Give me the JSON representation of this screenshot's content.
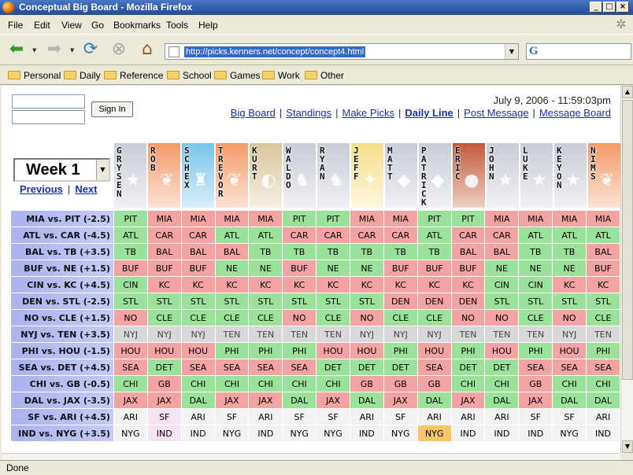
{
  "window": {
    "title": "Conceptual Big Board - Mozilla Firefox"
  },
  "menu": [
    "File",
    "Edit",
    "View",
    "Go",
    "Bookmarks",
    "Tools",
    "Help"
  ],
  "address": {
    "url": "http://picks.kenners.net/concept/concept4.html"
  },
  "search": {
    "engine_glyph": "G"
  },
  "bookmarks": [
    "Personal",
    "Daily",
    "Reference",
    "School",
    "Games",
    "Work",
    "Other"
  ],
  "page": {
    "signin_label": "Sign In",
    "datetime": "July 9, 2006 - 11:59:03pm",
    "nav_links": [
      "Big Board",
      "Standings",
      "Make Picks",
      "Daily Line",
      "Post Message",
      "Message Board"
    ],
    "current_link": "Daily Line",
    "week_label": "Week 1",
    "prev_label": "Previous",
    "next_label": "Next"
  },
  "players": [
    {
      "name": "GRYSEN",
      "bg": "#c8ccd6",
      "logo": "star-logo"
    },
    {
      "name": "ROB",
      "bg": "#f39a6a",
      "logo": "bird-logo"
    },
    {
      "name": "SCHEX",
      "bg": "#79c4ea",
      "logo": "derrick-logo"
    },
    {
      "name": "TREVOR",
      "bg": "#f39a6a",
      "logo": "bird-logo"
    },
    {
      "name": "KURT",
      "bg": "#d9c79a",
      "logo": "helmet-logo"
    },
    {
      "name": "WALDO",
      "bg": "#c8ccd6",
      "logo": "horse-logo"
    },
    {
      "name": "RYAN",
      "bg": "#c8ccd6",
      "logo": "horse-logo"
    },
    {
      "name": "JEFF",
      "bg": "#f6df8a",
      "logo": "steel-logo"
    },
    {
      "name": "MATT",
      "bg": "#c8ccd6",
      "logo": "patriot-logo"
    },
    {
      "name": "PATRICK",
      "bg": "#c8ccd6",
      "logo": "patriot-logo"
    },
    {
      "name": "ERIC",
      "bg": "#c25a3a",
      "logo": "chief-logo"
    },
    {
      "name": "JOHN",
      "bg": "#c8ccd6",
      "logo": "star-logo"
    },
    {
      "name": "LUKE",
      "bg": "#c8ccd6",
      "logo": "star-logo"
    },
    {
      "name": "KEYON",
      "bg": "#c8ccd6",
      "logo": "star-logo"
    },
    {
      "name": "NIMS",
      "bg": "#f39a6a",
      "logo": "bird-logo"
    }
  ],
  "games": [
    {
      "label": "MIA vs. PIT (-2.5)",
      "picks": [
        [
          "PIT",
          "w"
        ],
        [
          "MIA",
          "l"
        ],
        [
          "MIA",
          "l"
        ],
        [
          "MIA",
          "l"
        ],
        [
          "MIA",
          "l"
        ],
        [
          "PIT",
          "w"
        ],
        [
          "PIT",
          "w"
        ],
        [
          "MIA",
          "l"
        ],
        [
          "MIA",
          "l"
        ],
        [
          "PIT",
          "w"
        ],
        [
          "PIT",
          "w"
        ],
        [
          "MIA",
          "l"
        ],
        [
          "MIA",
          "l"
        ],
        [
          "MIA",
          "l"
        ],
        [
          "MIA",
          "l"
        ]
      ]
    },
    {
      "label": "ATL vs. CAR (-4.5)",
      "picks": [
        [
          "ATL",
          "w"
        ],
        [
          "CAR",
          "l"
        ],
        [
          "CAR",
          "l"
        ],
        [
          "ATL",
          "w"
        ],
        [
          "ATL",
          "w"
        ],
        [
          "CAR",
          "l"
        ],
        [
          "CAR",
          "l"
        ],
        [
          "CAR",
          "l"
        ],
        [
          "CAR",
          "l"
        ],
        [
          "ATL",
          "w"
        ],
        [
          "CAR",
          "l"
        ],
        [
          "CAR",
          "l"
        ],
        [
          "ATL",
          "w"
        ],
        [
          "ATL",
          "w"
        ],
        [
          "ATL",
          "w"
        ]
      ]
    },
    {
      "label": "BAL vs. TB (+3.5)",
      "picks": [
        [
          "TB",
          "w"
        ],
        [
          "BAL",
          "l"
        ],
        [
          "BAL",
          "l"
        ],
        [
          "BAL",
          "l"
        ],
        [
          "TB",
          "w"
        ],
        [
          "TB",
          "w"
        ],
        [
          "TB",
          "w"
        ],
        [
          "TB",
          "w"
        ],
        [
          "TB",
          "w"
        ],
        [
          "TB",
          "w"
        ],
        [
          "BAL",
          "l"
        ],
        [
          "BAL",
          "l"
        ],
        [
          "TB",
          "w"
        ],
        [
          "TB",
          "w"
        ],
        [
          "BAL",
          "l"
        ]
      ]
    },
    {
      "label": "BUF vs. NE (+1.5)",
      "picks": [
        [
          "BUF",
          "l"
        ],
        [
          "BUF",
          "l"
        ],
        [
          "BUF",
          "l"
        ],
        [
          "NE",
          "w"
        ],
        [
          "NE",
          "w"
        ],
        [
          "BUF",
          "l"
        ],
        [
          "NE",
          "w"
        ],
        [
          "NE",
          "w"
        ],
        [
          "BUF",
          "l"
        ],
        [
          "BUF",
          "l"
        ],
        [
          "BUF",
          "l"
        ],
        [
          "NE",
          "w"
        ],
        [
          "NE",
          "w"
        ],
        [
          "NE",
          "w"
        ],
        [
          "BUF",
          "l"
        ]
      ]
    },
    {
      "label": "CIN vs. KC (+4.5)",
      "picks": [
        [
          "CIN",
          "w"
        ],
        [
          "KC",
          "l"
        ],
        [
          "KC",
          "l"
        ],
        [
          "KC",
          "l"
        ],
        [
          "KC",
          "l"
        ],
        [
          "KC",
          "l"
        ],
        [
          "KC",
          "l"
        ],
        [
          "KC",
          "l"
        ],
        [
          "KC",
          "l"
        ],
        [
          "KC",
          "l"
        ],
        [
          "KC",
          "l"
        ],
        [
          "CIN",
          "w"
        ],
        [
          "CIN",
          "w"
        ],
        [
          "KC",
          "l"
        ],
        [
          "KC",
          "l"
        ]
      ]
    },
    {
      "label": "DEN vs. STL (-2.5)",
      "picks": [
        [
          "STL",
          "w"
        ],
        [
          "STL",
          "w"
        ],
        [
          "STL",
          "w"
        ],
        [
          "STL",
          "w"
        ],
        [
          "STL",
          "w"
        ],
        [
          "STL",
          "w"
        ],
        [
          "STL",
          "w"
        ],
        [
          "STL",
          "w"
        ],
        [
          "DEN",
          "l"
        ],
        [
          "DEN",
          "l"
        ],
        [
          "DEN",
          "l"
        ],
        [
          "STL",
          "w"
        ],
        [
          "STL",
          "w"
        ],
        [
          "STL",
          "w"
        ],
        [
          "STL",
          "w"
        ]
      ]
    },
    {
      "label": "NO vs. CLE (+1.5)",
      "picks": [
        [
          "NO",
          "l"
        ],
        [
          "CLE",
          "w"
        ],
        [
          "CLE",
          "w"
        ],
        [
          "CLE",
          "w"
        ],
        [
          "CLE",
          "w"
        ],
        [
          "NO",
          "l"
        ],
        [
          "CLE",
          "w"
        ],
        [
          "NO",
          "l"
        ],
        [
          "CLE",
          "w"
        ],
        [
          "CLE",
          "w"
        ],
        [
          "NO",
          "l"
        ],
        [
          "NO",
          "l"
        ],
        [
          "CLE",
          "w"
        ],
        [
          "NO",
          "l"
        ],
        [
          "CLE",
          "w"
        ]
      ]
    },
    {
      "label": "NYJ vs. TEN (+3.5)",
      "picks": [
        [
          "NYJ",
          "t"
        ],
        [
          "NYJ",
          "t"
        ],
        [
          "NYJ",
          "t"
        ],
        [
          "TEN",
          "t"
        ],
        [
          "TEN",
          "t"
        ],
        [
          "TEN",
          "t"
        ],
        [
          "TEN",
          "t"
        ],
        [
          "NYJ",
          "t"
        ],
        [
          "NYJ",
          "t"
        ],
        [
          "NYJ",
          "t"
        ],
        [
          "TEN",
          "t"
        ],
        [
          "TEN",
          "t"
        ],
        [
          "TEN",
          "t"
        ],
        [
          "NYJ",
          "t"
        ],
        [
          "TEN",
          "t"
        ]
      ]
    },
    {
      "label": "PHI vs. HOU (-1.5)",
      "picks": [
        [
          "HOU",
          "l"
        ],
        [
          "HOU",
          "l"
        ],
        [
          "HOU",
          "l"
        ],
        [
          "PHI",
          "w"
        ],
        [
          "PHI",
          "w"
        ],
        [
          "PHI",
          "w"
        ],
        [
          "HOU",
          "l"
        ],
        [
          "HOU",
          "l"
        ],
        [
          "PHI",
          "w"
        ],
        [
          "HOU",
          "l"
        ],
        [
          "PHI",
          "w"
        ],
        [
          "HOU",
          "l"
        ],
        [
          "PHI",
          "w"
        ],
        [
          "HOU",
          "l"
        ],
        [
          "PHI",
          "w"
        ]
      ]
    },
    {
      "label": "SEA vs. DET (+4.5)",
      "picks": [
        [
          "SEA",
          "l"
        ],
        [
          "DET",
          "w"
        ],
        [
          "SEA",
          "l"
        ],
        [
          "SEA",
          "l"
        ],
        [
          "SEA",
          "l"
        ],
        [
          "SEA",
          "l"
        ],
        [
          "DET",
          "w"
        ],
        [
          "DET",
          "w"
        ],
        [
          "DET",
          "w"
        ],
        [
          "SEA",
          "l"
        ],
        [
          "DET",
          "w"
        ],
        [
          "DET",
          "w"
        ],
        [
          "SEA",
          "l"
        ],
        [
          "SEA",
          "l"
        ],
        [
          "SEA",
          "l"
        ]
      ]
    },
    {
      "label": "CHI vs. GB (-0.5)",
      "picks": [
        [
          "CHI",
          "w"
        ],
        [
          "GB",
          "l"
        ],
        [
          "CHI",
          "w"
        ],
        [
          "CHI",
          "w"
        ],
        [
          "CHI",
          "w"
        ],
        [
          "CHI",
          "w"
        ],
        [
          "CHI",
          "w"
        ],
        [
          "GB",
          "l"
        ],
        [
          "GB",
          "l"
        ],
        [
          "GB",
          "l"
        ],
        [
          "CHI",
          "w"
        ],
        [
          "CHI",
          "w"
        ],
        [
          "GB",
          "l"
        ],
        [
          "CHI",
          "w"
        ],
        [
          "CHI",
          "w"
        ]
      ]
    },
    {
      "label": "DAL vs. JAX (-3.5)",
      "picks": [
        [
          "JAX",
          "l"
        ],
        [
          "JAX",
          "l"
        ],
        [
          "DAL",
          "w"
        ],
        [
          "JAX",
          "l"
        ],
        [
          "JAX",
          "l"
        ],
        [
          "DAL",
          "w"
        ],
        [
          "JAX",
          "l"
        ],
        [
          "DAL",
          "w"
        ],
        [
          "JAX",
          "l"
        ],
        [
          "DAL",
          "w"
        ],
        [
          "JAX",
          "l"
        ],
        [
          "DAL",
          "w"
        ],
        [
          "JAX",
          "l"
        ],
        [
          "DAL",
          "w"
        ],
        [
          "DAL",
          "w"
        ]
      ]
    },
    {
      "label": "SF vs. ARI (+4.5)",
      "picks": [
        [
          "ARI",
          "o"
        ],
        [
          "SF",
          "p"
        ],
        [
          "ARI",
          "o"
        ],
        [
          "SF",
          "o"
        ],
        [
          "ARI",
          "o"
        ],
        [
          "SF",
          "o"
        ],
        [
          "SF",
          "o"
        ],
        [
          "ARI",
          "o"
        ],
        [
          "SF",
          "o"
        ],
        [
          "ARI",
          "o"
        ],
        [
          "ARI",
          "o"
        ],
        [
          "ARI",
          "o"
        ],
        [
          "SF",
          "o"
        ],
        [
          "SF",
          "o"
        ],
        [
          "ARI",
          "o"
        ]
      ]
    },
    {
      "label": "IND vs. NYG (+3.5)",
      "picks": [
        [
          "NYG",
          "o"
        ],
        [
          "IND",
          "p"
        ],
        [
          "IND",
          "o"
        ],
        [
          "NYG",
          "o"
        ],
        [
          "IND",
          "o"
        ],
        [
          "NYG",
          "o"
        ],
        [
          "NYG",
          "o"
        ],
        [
          "IND",
          "o"
        ],
        [
          "NYG",
          "o"
        ],
        [
          "NYG",
          "g"
        ],
        [
          "IND",
          "o"
        ],
        [
          "IND",
          "o"
        ],
        [
          "IND",
          "o"
        ],
        [
          "NYG",
          "o"
        ],
        [
          "IND",
          "o"
        ]
      ]
    }
  ],
  "status": {
    "text": "Done"
  }
}
